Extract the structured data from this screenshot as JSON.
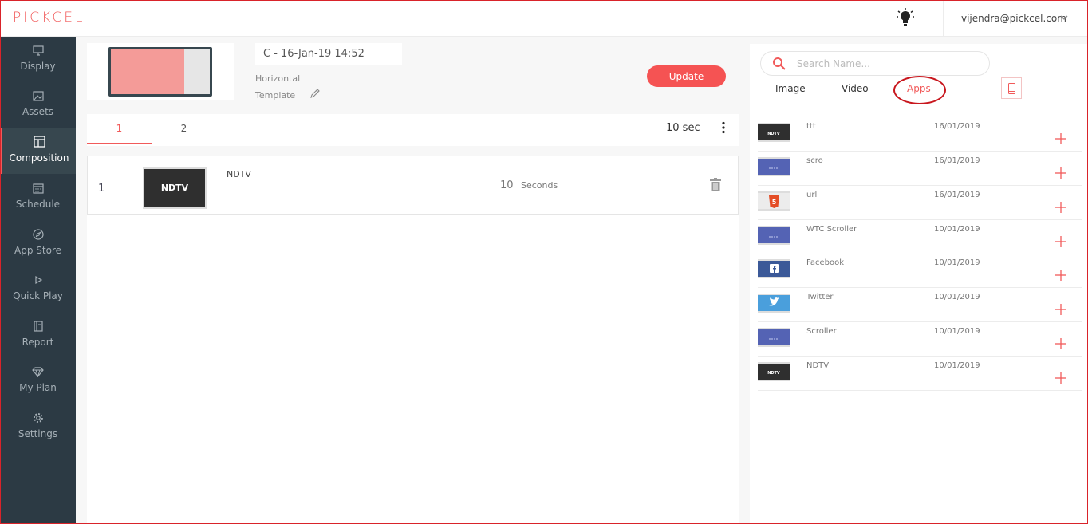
{
  "header": {
    "logo": "PICKCEL",
    "user_email": "vijendra@pickcel.com"
  },
  "sidebar": {
    "items": [
      {
        "label": "Display",
        "icon": "monitor-icon"
      },
      {
        "label": "Assets",
        "icon": "image-icon"
      },
      {
        "label": "Composition",
        "icon": "layout-icon",
        "active": true
      },
      {
        "label": "Schedule",
        "icon": "calendar-icon"
      },
      {
        "label": "App Store",
        "icon": "compass-icon"
      },
      {
        "label": "Quick Play",
        "icon": "play-icon"
      },
      {
        "label": "Report",
        "icon": "report-icon"
      },
      {
        "label": "My Plan",
        "icon": "diamond-icon"
      },
      {
        "label": "Settings",
        "icon": "gear-icon"
      }
    ]
  },
  "composition": {
    "name": "C - 16-Jan-19 14:52",
    "orientation": "Horizontal",
    "template_label": "Template",
    "update_label": "Update",
    "zone_tabs": [
      "1",
      "2"
    ],
    "total_duration": "10 sec",
    "media": [
      {
        "index": "1",
        "thumb_text": "NDTV",
        "name": "NDTV",
        "duration": "10",
        "unit": "Seconds"
      }
    ]
  },
  "library": {
    "search_placeholder": "Search Name...",
    "tabs": [
      "Image",
      "Video",
      "Apps"
    ],
    "active_tab": "Apps",
    "apps": [
      {
        "name": "ttt",
        "date": "16/01/2019",
        "thumb": "ndtv"
      },
      {
        "name": "scro",
        "date": "16/01/2019",
        "thumb": "scroller"
      },
      {
        "name": "url",
        "date": "16/01/2019",
        "thumb": "html5"
      },
      {
        "name": "WTC Scroller",
        "date": "10/01/2019",
        "thumb": "scroller"
      },
      {
        "name": "Facebook",
        "date": "10/01/2019",
        "thumb": "facebook"
      },
      {
        "name": "Twitter",
        "date": "10/01/2019",
        "thumb": "twitter"
      },
      {
        "name": "Scroller",
        "date": "10/01/2019",
        "thumb": "scroller"
      },
      {
        "name": "NDTV",
        "date": "10/01/2019",
        "thumb": "ndtv"
      }
    ]
  },
  "colors": {
    "accent": "#f15a5a",
    "sidebar_bg": "#2c3a44",
    "annotation": "#c8161d"
  }
}
